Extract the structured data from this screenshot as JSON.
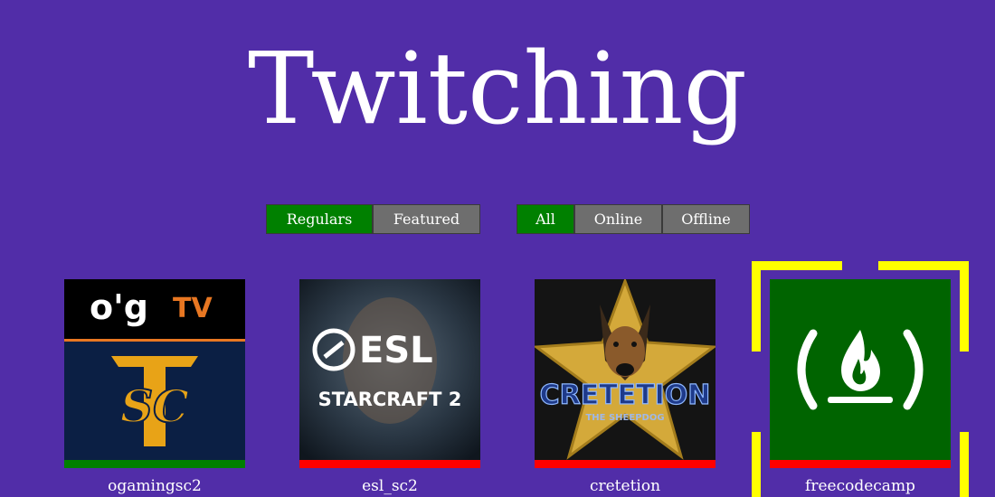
{
  "app": {
    "title": "Twitching"
  },
  "filters": {
    "category": [
      {
        "label": "Regulars",
        "active": true
      },
      {
        "label": "Featured",
        "active": false
      }
    ],
    "status": [
      {
        "label": "All",
        "active": true
      },
      {
        "label": "Online",
        "active": false
      },
      {
        "label": "Offline",
        "active": false
      }
    ]
  },
  "channels": [
    {
      "name": "ogamingsc2",
      "status": "online",
      "logo_text_top": "o'g",
      "logo_text_tv": "TV",
      "logo_text_bottom": "SC"
    },
    {
      "name": "esl_sc2",
      "status": "offline",
      "logo_text_top": "ESL",
      "logo_text_bottom": "STARCRAFT 2"
    },
    {
      "name": "cretetion",
      "status": "offline",
      "logo_text_top": "CRETETION",
      "logo_text_bottom": "THE SHEEPDOG"
    },
    {
      "name": "freecodecamp",
      "status": "offline",
      "selected": true,
      "logo_text_top": "( )"
    }
  ],
  "colors": {
    "background": "#512da8",
    "active_button": "#008000",
    "inactive_button": "#6e6e6e",
    "online": "#008000",
    "offline": "#ff0000",
    "selection": "#ffff00",
    "freecodecamp_bg": "#006400"
  }
}
